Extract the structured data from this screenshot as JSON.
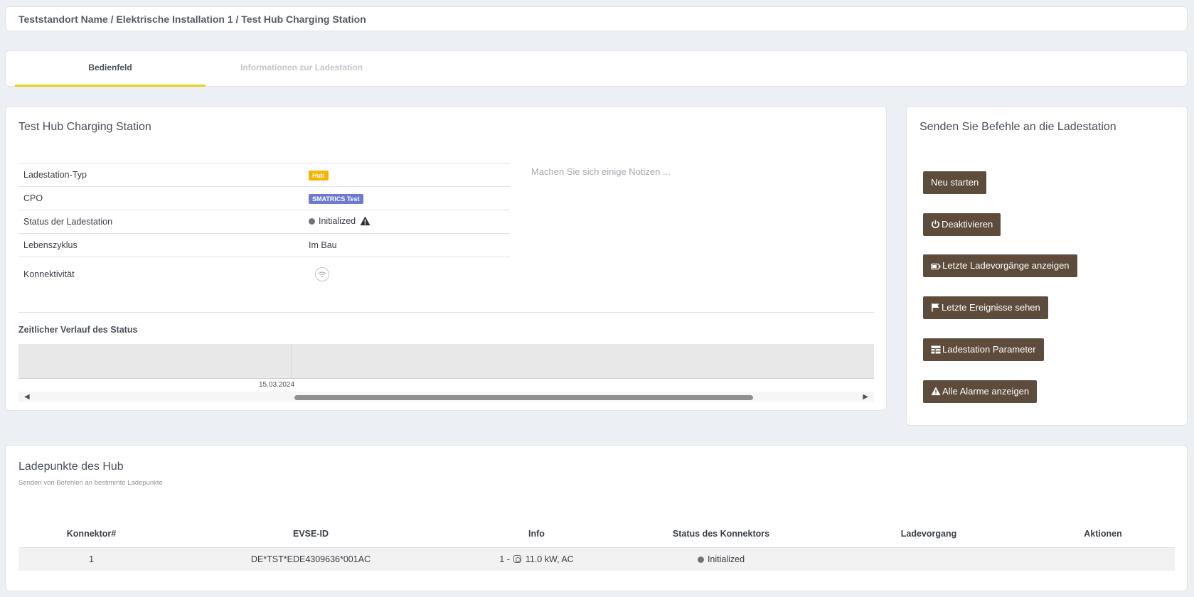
{
  "breadcrumb": "Teststandort Name / Elektrische Installation 1 / Test Hub Charging Station",
  "tabs": [
    {
      "label": "Bedienfeld",
      "active": true
    },
    {
      "label": "Informationen zur Ladestation",
      "active": false
    }
  ],
  "station": {
    "title": "Test Hub Charging Station",
    "rows": {
      "type": {
        "label": "Ladestation-Typ",
        "value": "Hub"
      },
      "cpo": {
        "label": "CPO",
        "value": "SMATRICS Test"
      },
      "status": {
        "label": "Status der Ladestation",
        "value": "Initialized"
      },
      "lifecycle": {
        "label": "Lebenszyklus",
        "value": "Im Bau"
      },
      "connectivity": {
        "label": "Konnektivität"
      }
    },
    "notes_placeholder": "Machen Sie sich einige Notizen ...",
    "timeline": {
      "heading": "Zeitlicher Verlauf des Status",
      "date_label": "15.03.2024"
    }
  },
  "commands": {
    "title": "Senden Sie Befehle an die Ladestation",
    "buttons": {
      "restart": "Neu starten",
      "deactivate": "Deaktivieren",
      "sessions": "Letzte Ladevorgänge anzeigen",
      "events": "Letzte Ereignisse sehen",
      "params": "Ladestation Parameter",
      "alarms": "Alle Alarme anzeigen"
    }
  },
  "hub": {
    "title": "Ladepunkte des Hub",
    "subtitle": "Senden von Befehlen an bestimmte Ladepunkte",
    "columns": [
      "Konnektor#",
      "EVSE-ID",
      "Info",
      "Status des Konnektors",
      "Ladevorgang",
      "Aktionen"
    ],
    "rows": [
      {
        "connector": "1",
        "evse": "DE*TST*EDE4309636*001AC",
        "info_prefix": "1 -",
        "info": "11.0 kW, AC",
        "status": "Initialized",
        "session": "",
        "actions": ""
      }
    ]
  },
  "colors": {
    "accent": "#e6d21a",
    "button": "#5d4c3b",
    "badge_hub": "#f5b400",
    "badge_cpo": "#6d7ad0",
    "status_dot": "#6f7378"
  }
}
